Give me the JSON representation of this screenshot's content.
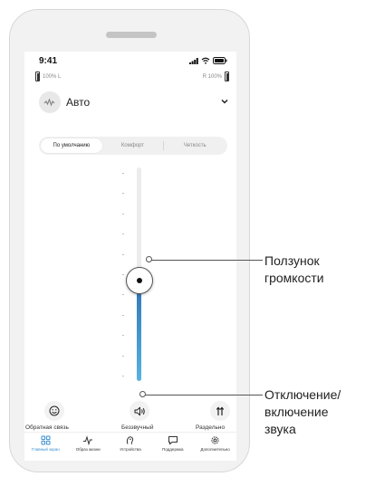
{
  "status_bar": {
    "time": "9:41"
  },
  "battery": {
    "left_label": "100% L",
    "right_label": "R 100%"
  },
  "program": {
    "name": "Авто"
  },
  "segments": [
    {
      "label": "По умолчанию",
      "active": true
    },
    {
      "label": "Комфорт",
      "active": false
    },
    {
      "label": "Четкость",
      "active": false
    }
  ],
  "volume_slider": {
    "level_percent": 47
  },
  "actions": {
    "feedback_label": "Обратная связь",
    "mute_label": "Беззвучный",
    "split_label": "Раздельно"
  },
  "bottom_nav": [
    {
      "label": "Главный экран",
      "icon": "grid-icon",
      "active": true
    },
    {
      "label": "Образ жизни",
      "icon": "activity-icon",
      "active": false
    },
    {
      "label": "Устройства",
      "icon": "hearing-aid-icon",
      "active": false
    },
    {
      "label": "Поддержка",
      "icon": "chat-icon",
      "active": false
    },
    {
      "label": "Дополнительно",
      "icon": "gear-icon",
      "active": false
    }
  ],
  "callouts": {
    "volume_slider": {
      "line1": "Ползунок",
      "line2": "громкости"
    },
    "mute": {
      "line1": "Отключение/",
      "line2": "включение",
      "line3": "звука"
    }
  },
  "colors": {
    "accent": "#3a8ed0",
    "slider_top": "#2f74b8",
    "slider_bottom": "#55b3e0"
  }
}
